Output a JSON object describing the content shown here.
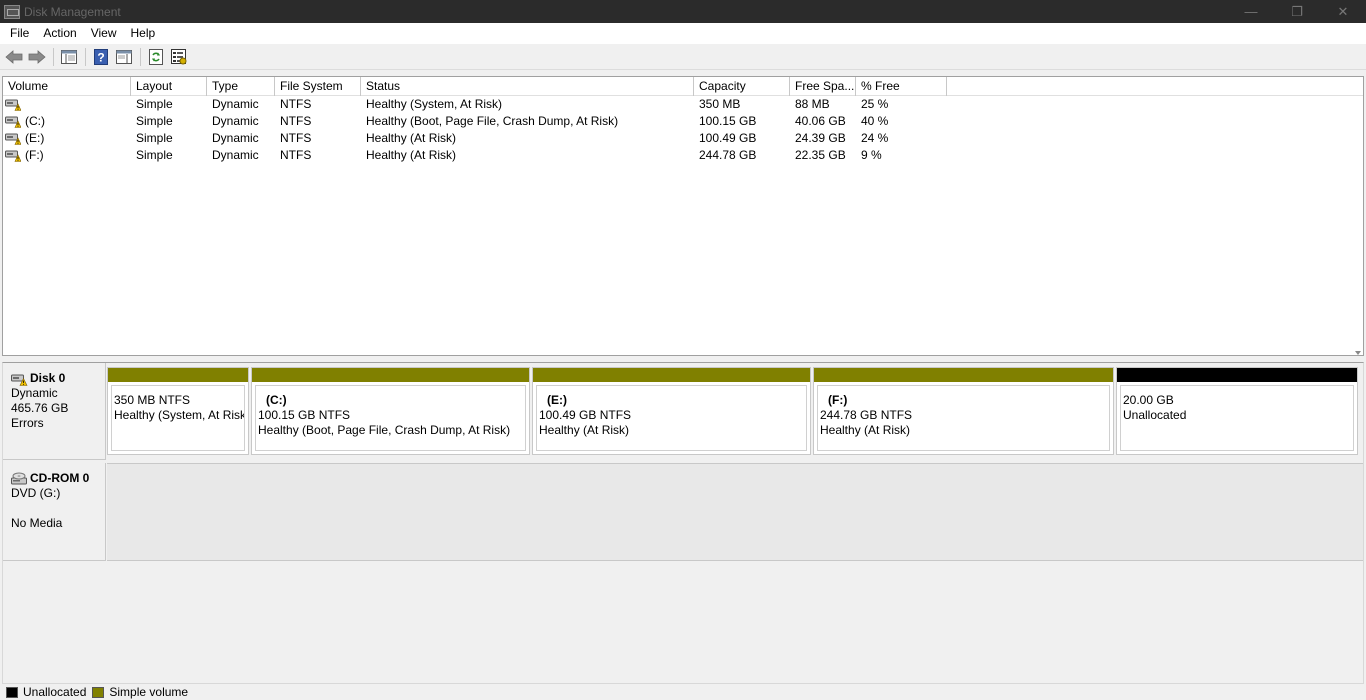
{
  "window": {
    "title": "Disk Management",
    "controls": [
      "—",
      "❐",
      "✕"
    ]
  },
  "menu": [
    "File",
    "Action",
    "View",
    "Help"
  ],
  "toolbar": [
    "back-icon",
    "forward-icon",
    "console-tree-icon",
    "help-icon",
    "action-pane-icon",
    "refresh-icon",
    "properties-icon"
  ],
  "volume_table": {
    "columns": [
      "Volume",
      "Layout",
      "Type",
      "File System",
      "Status",
      "Capacity",
      "Free Spa...",
      "% Free"
    ],
    "rows": [
      [
        "",
        "Simple",
        "Dynamic",
        "NTFS",
        "Healthy (System, At Risk)",
        "350 MB",
        "88 MB",
        "25 %"
      ],
      [
        "(C:)",
        "Simple",
        "Dynamic",
        "NTFS",
        "Healthy (Boot, Page File, Crash Dump, At Risk)",
        "100.15 GB",
        "40.06 GB",
        "40 %"
      ],
      [
        "(E:)",
        "Simple",
        "Dynamic",
        "NTFS",
        "Healthy (At Risk)",
        "100.49 GB",
        "24.39 GB",
        "24 %"
      ],
      [
        "(F:)",
        "Simple",
        "Dynamic",
        "NTFS",
        "Healthy (At Risk)",
        "244.78 GB",
        "22.35 GB",
        "9 %"
      ]
    ]
  },
  "disks": [
    {
      "name": "Disk 0",
      "lines": [
        "Dynamic",
        "465.76 GB",
        "Errors"
      ],
      "partitions": [
        {
          "name": "",
          "size": "350 MB NTFS",
          "status": "Healthy (System, At Risk",
          "kind": "simple"
        },
        {
          "name": "(C:)",
          "size": "100.15 GB NTFS",
          "status": "Healthy (Boot, Page File, Crash Dump, At Risk)",
          "kind": "simple"
        },
        {
          "name": "(E:)",
          "size": "100.49 GB NTFS",
          "status": "Healthy (At Risk)",
          "kind": "simple"
        },
        {
          "name": "(F:)",
          "size": "244.78 GB NTFS",
          "status": "Healthy (At Risk)",
          "kind": "simple"
        },
        {
          "name": "",
          "size": "20.00 GB",
          "status": "Unallocated",
          "kind": "unallocated"
        }
      ]
    },
    {
      "name": "CD-ROM 0",
      "lines": [
        "DVD (G:)",
        "",
        "No Media"
      ]
    }
  ],
  "legend": [
    {
      "label": "Unallocated",
      "color": "#000000"
    },
    {
      "label": "Simple volume",
      "color": "#808000"
    }
  ],
  "colors": {
    "simple": "#808000",
    "unallocated": "#000000"
  }
}
